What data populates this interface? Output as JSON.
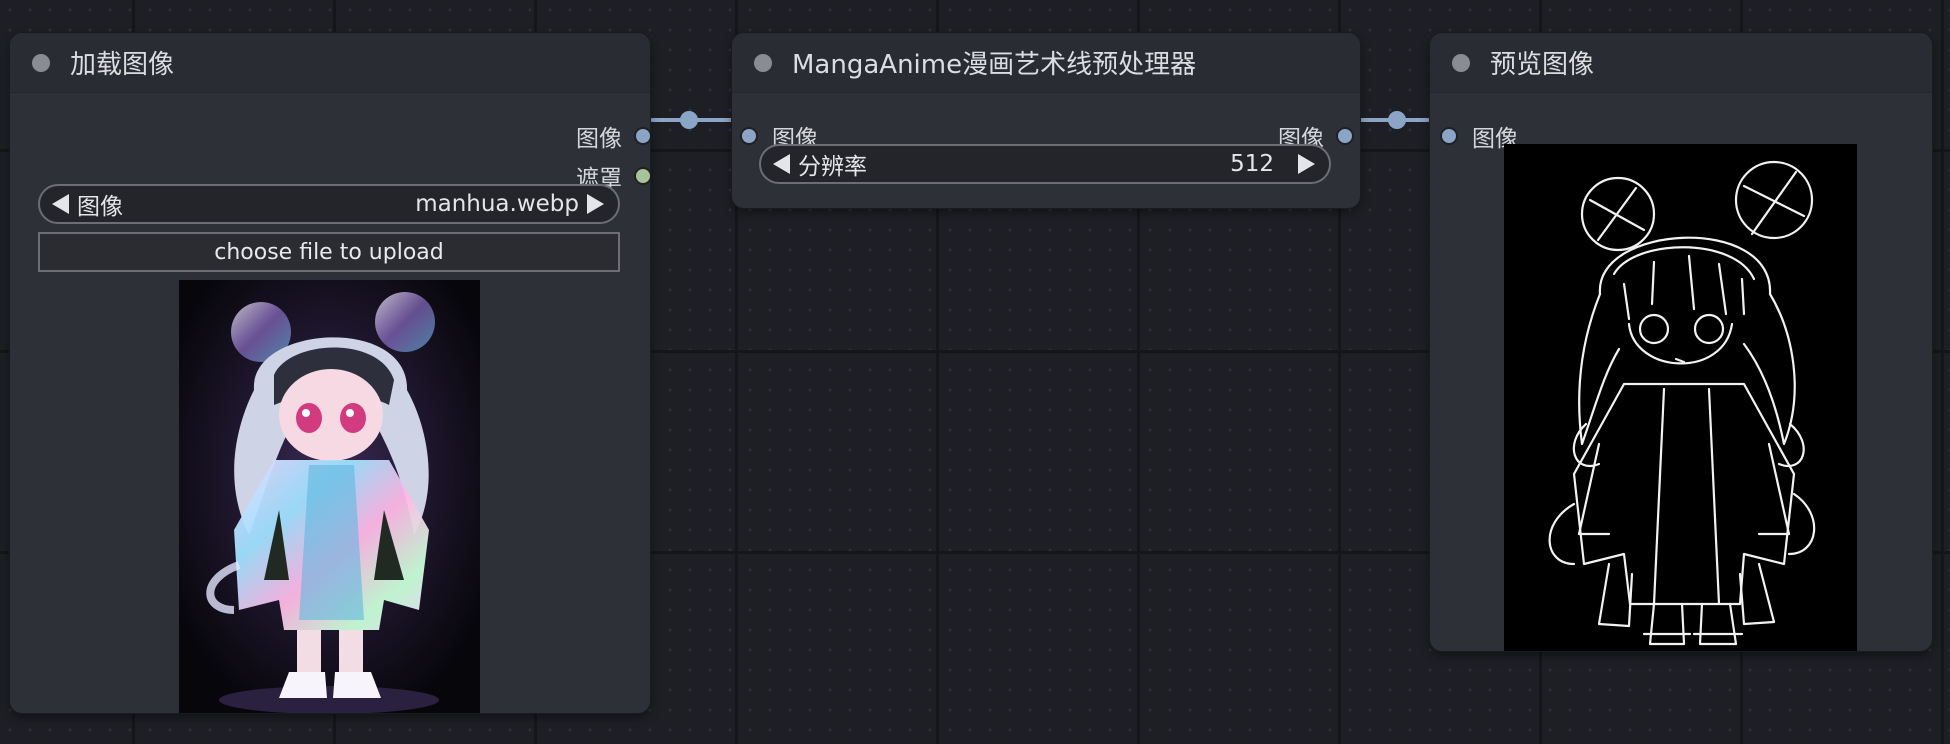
{
  "nodes": {
    "load_image": {
      "title": "加载图像",
      "outputs": [
        "图像",
        "遮罩"
      ],
      "image_widget": {
        "label": "图像",
        "value": "manhua.webp"
      },
      "upload_label": "choose file to upload"
    },
    "preprocessor": {
      "title": "MangaAnime漫画艺术线预处理器",
      "input": "图像",
      "output": "图像",
      "resolution_widget": {
        "label": "分辨率",
        "value": "512"
      }
    },
    "preview": {
      "title": "预览图像",
      "input": "图像"
    }
  },
  "colors": {
    "image_port": "#8aa5c6",
    "mask_port": "#a8c29a",
    "node_body": "#2e3038",
    "canvas": "#1d1f24"
  }
}
